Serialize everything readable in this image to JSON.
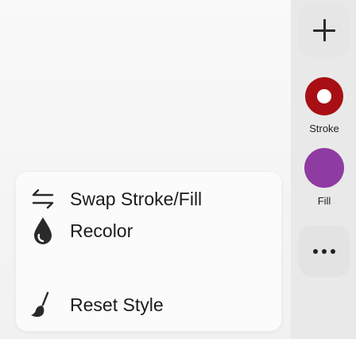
{
  "toolbar": {
    "add_icon": "plus-icon",
    "stroke_label": "Stroke",
    "stroke_color": "#a80f14",
    "fill_label": "Fill",
    "fill_color": "#8e3ba2",
    "more_icon": "ellipsis-icon"
  },
  "menu": {
    "items": [
      {
        "label": "Swap Stroke/Fill",
        "icon": "swap-arrows-icon"
      },
      {
        "label": "Recolor",
        "icon": "droplet-icon"
      },
      {
        "label": "Reset Style",
        "icon": "brush-icon"
      }
    ]
  }
}
